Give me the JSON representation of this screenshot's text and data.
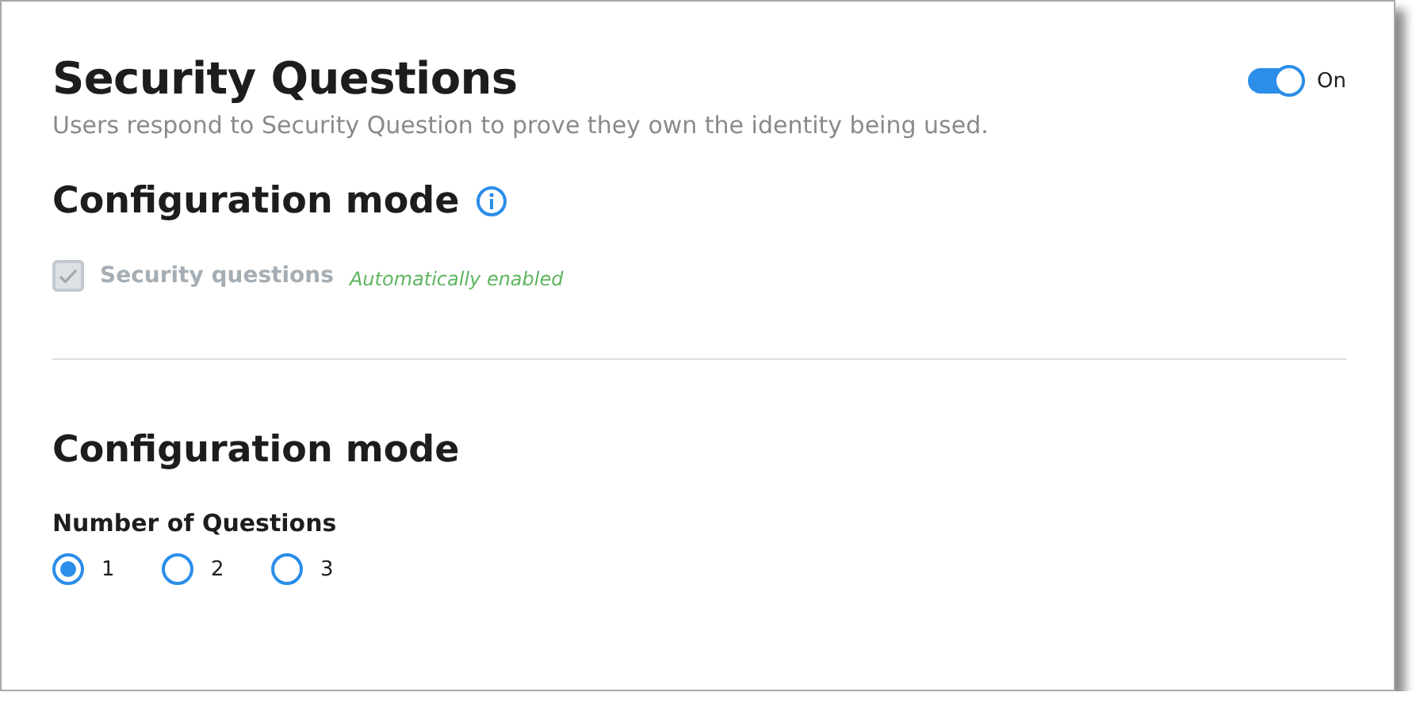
{
  "header": {
    "title": "Security Questions",
    "description": "Users respond to Security Question to prove they own the identity being used.",
    "toggle": {
      "on": true,
      "label": "On"
    }
  },
  "config_section": {
    "heading": "Configuration mode",
    "option": {
      "label": "Security questions",
      "checked": true,
      "disabled": true,
      "note": "Automatically enabled"
    }
  },
  "questions_section": {
    "heading": "Configuration mode",
    "field_label": "Number of Questions",
    "options": [
      {
        "label": "1",
        "selected": true
      },
      {
        "label": "2",
        "selected": false
      },
      {
        "label": "3",
        "selected": false
      }
    ]
  }
}
